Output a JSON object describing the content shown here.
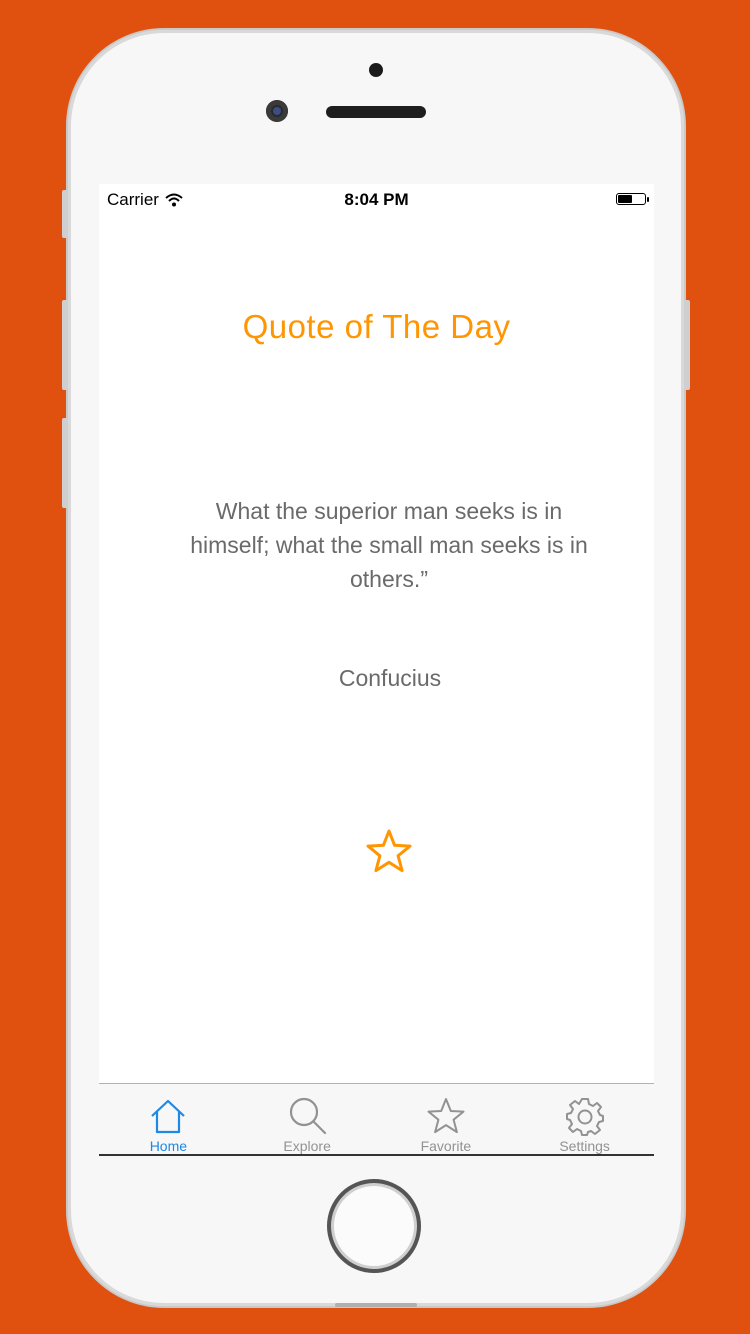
{
  "status_bar": {
    "carrier": "Carrier",
    "time": "8:04 PM",
    "battery_level": 0.5
  },
  "main": {
    "title": "Quote of The Day",
    "quote": "What the superior man seeks is in himself; what the small man seeks is in others.”",
    "author": "Confucius",
    "favorite_icon": "star-outline-icon"
  },
  "tab_bar": {
    "tabs": [
      {
        "label": "Home",
        "icon": "home-icon",
        "active": true
      },
      {
        "label": "Explore",
        "icon": "search-icon",
        "active": false
      },
      {
        "label": "Favorite",
        "icon": "star-icon",
        "active": false
      },
      {
        "label": "Settings",
        "icon": "gear-icon",
        "active": false
      }
    ]
  },
  "colors": {
    "background": "#E0500E",
    "accent_orange": "#FF9500",
    "active_tab": "#1E88E5",
    "inactive_tab": "#929292",
    "text_gray": "#6a6a6a"
  }
}
